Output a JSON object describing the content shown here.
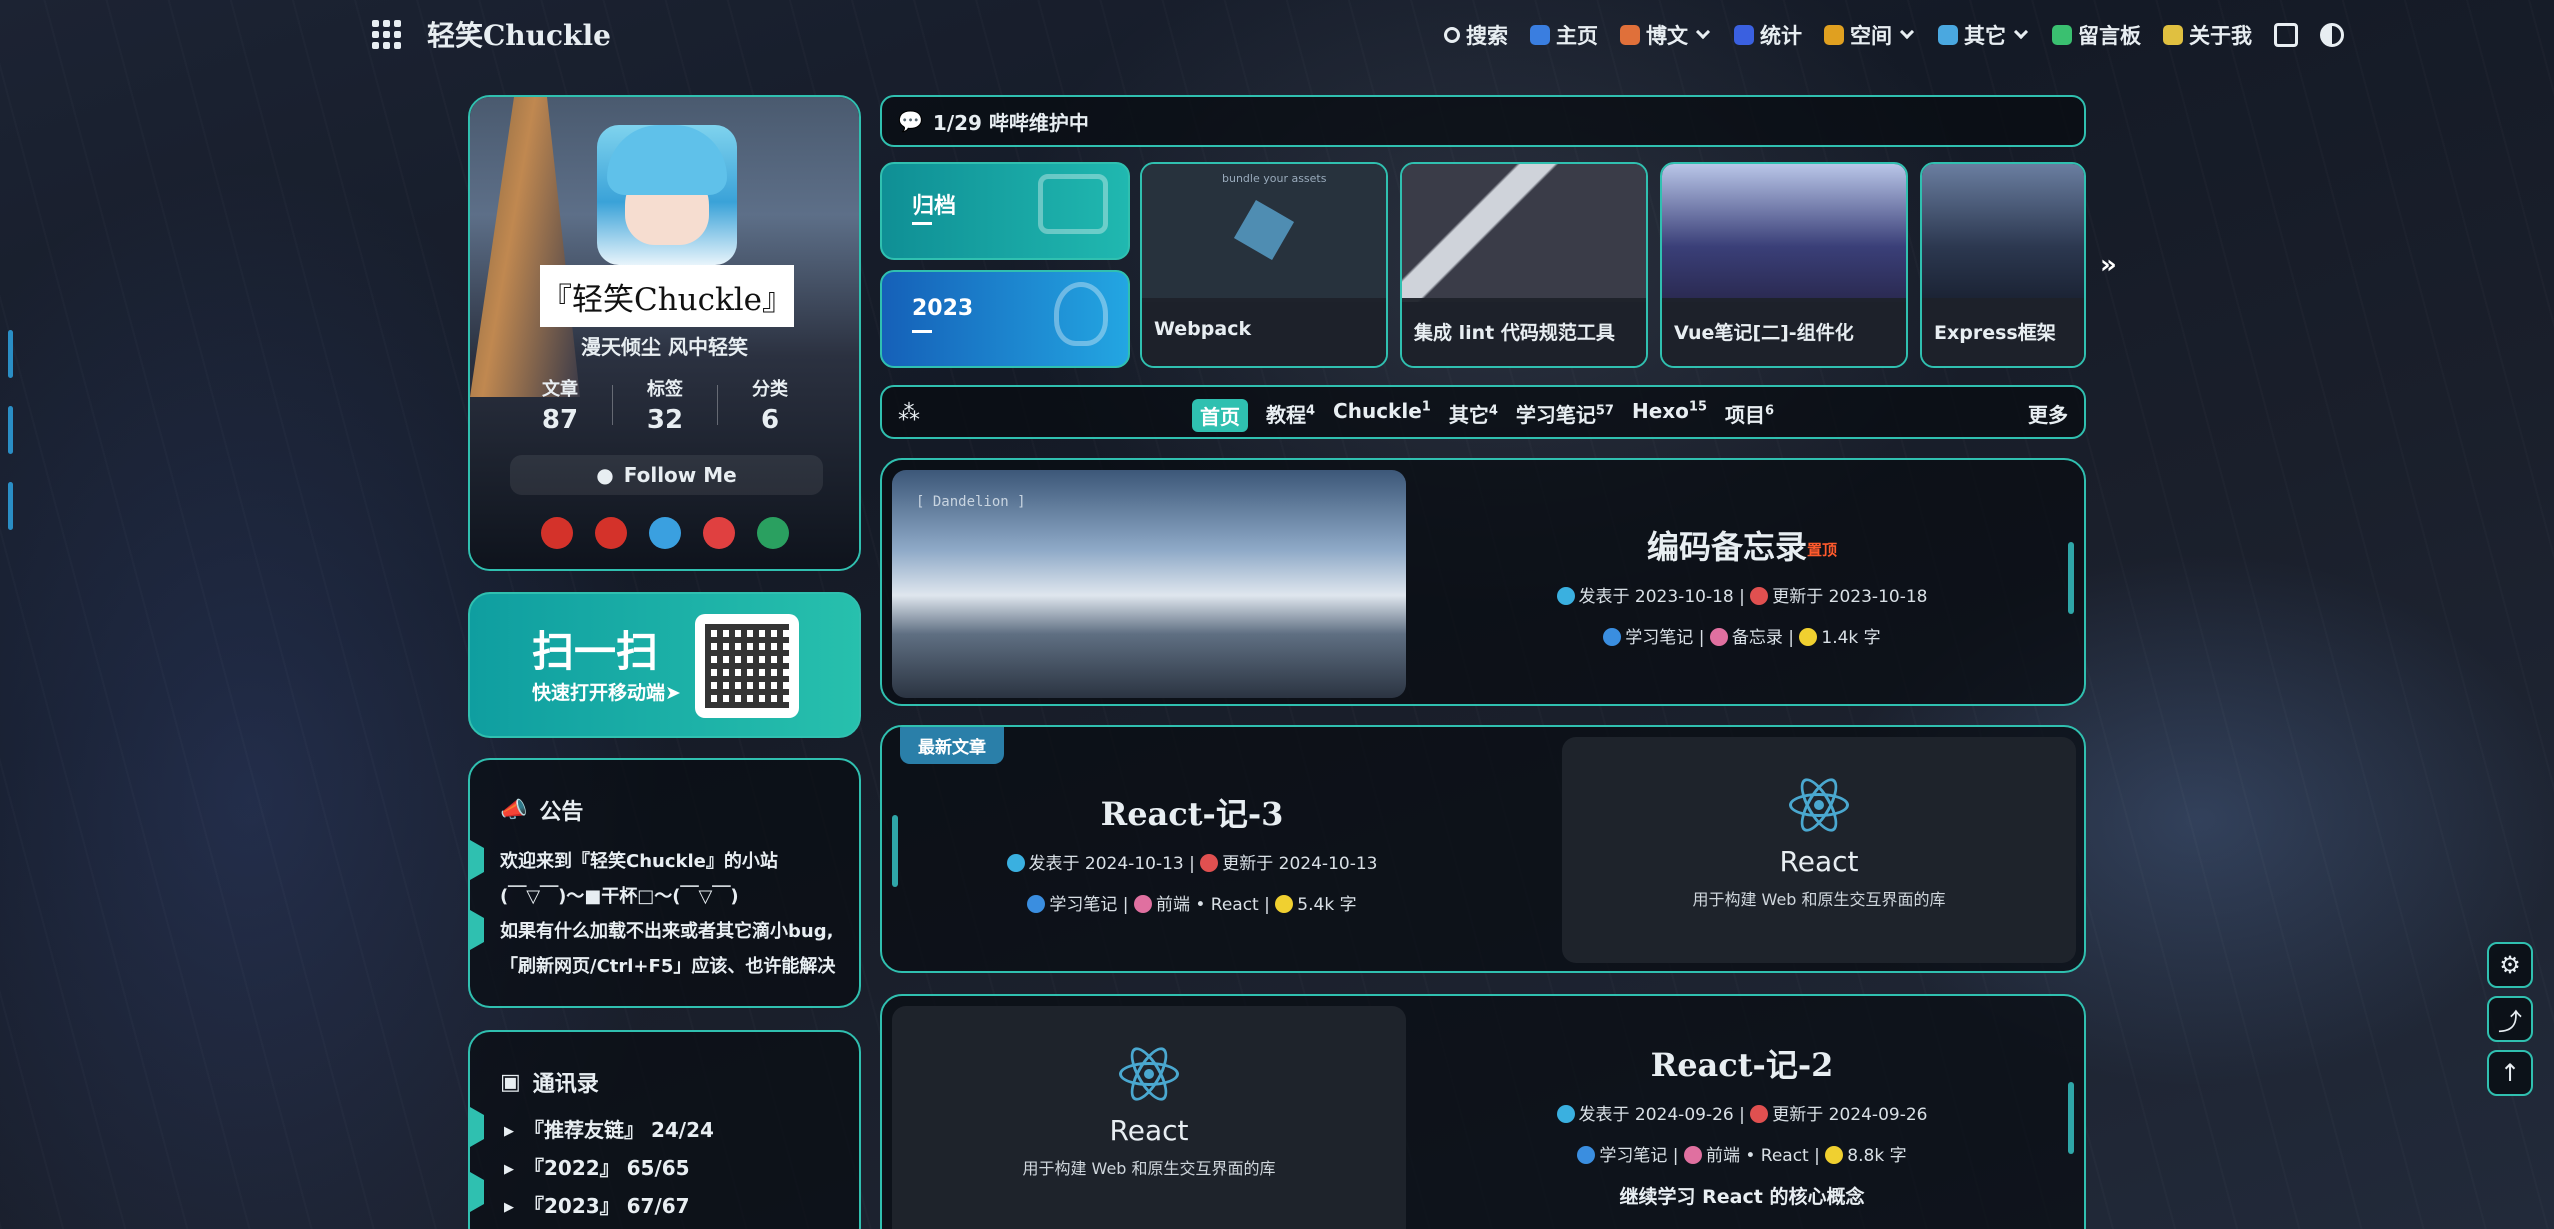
{
  "nav": {
    "brand": "轻笑Chuckle",
    "items": [
      {
        "label": "搜索",
        "icon": "search-icon",
        "color": "#e8eef2",
        "dropdown": false
      },
      {
        "label": "主页",
        "icon": "home-icon",
        "color": "#3a7ee0",
        "dropdown": false
      },
      {
        "label": "博文",
        "icon": "article-icon",
        "color": "#e0703a",
        "dropdown": true
      },
      {
        "label": "统计",
        "icon": "stats-icon",
        "color": "#3a60e0",
        "dropdown": false
      },
      {
        "label": "空间",
        "icon": "space-icon",
        "color": "#e0a020",
        "dropdown": true
      },
      {
        "label": "其它",
        "icon": "send-icon",
        "color": "#4aa8e0",
        "dropdown": true
      },
      {
        "label": "留言板",
        "icon": "message-icon",
        "color": "#3ac070",
        "dropdown": false
      },
      {
        "label": "关于我",
        "icon": "about-icon",
        "color": "#e0c040",
        "dropdown": false
      }
    ]
  },
  "profile": {
    "title": "『轻笑Chuckle』",
    "subtitle": "漫天倾尘 风中轻笑",
    "stats": [
      {
        "label": "文章",
        "value": "87"
      },
      {
        "label": "标签",
        "value": "32"
      },
      {
        "label": "分类",
        "value": "6"
      }
    ],
    "follow": "Follow Me",
    "socials": [
      {
        "name": "csdn-icon",
        "color": "#d4322a"
      },
      {
        "name": "gitee-icon",
        "color": "#d4322a"
      },
      {
        "name": "bilibili-icon",
        "color": "#3aa0e0"
      },
      {
        "name": "weibo-icon",
        "color": "#e04040"
      },
      {
        "name": "codepen-icon",
        "color": "#2aa060"
      }
    ]
  },
  "qr": {
    "title": "扫一扫",
    "subtitle": "快速打开移动端➤"
  },
  "notice": {
    "title": "公告",
    "lines": [
      "欢迎来到『轻笑Chuckle』的小站",
      "(￣▽￣)～■干杯□～(￣▽￣)",
      "如果有什么加载不出来或者其它滴小bug,",
      "「刷新网页/Ctrl+F5」应该、也许能解决"
    ]
  },
  "contact": {
    "title": "通讯录",
    "items": [
      "『推荐友链』 24/24",
      "『2022』 65/65",
      "『2023』 67/67"
    ]
  },
  "announce": "1/29 哔哔维护中",
  "categories": [
    {
      "label": "归档"
    },
    {
      "label": "2023"
    }
  ],
  "recent_posts": [
    {
      "title": "Webpack",
      "tone": "#27323d"
    },
    {
      "title": "集成 lint 代码规范工具",
      "tone": "#3a3c48"
    },
    {
      "title": "Vue笔记[二]-组件化",
      "tone": "#3a3f78"
    },
    {
      "title": "Express框架",
      "tone": "#2c3850"
    }
  ],
  "tabs": {
    "items": [
      {
        "label": "首页",
        "count": "",
        "active": true
      },
      {
        "label": "教程",
        "count": "4",
        "active": false
      },
      {
        "label": "Chuckle",
        "count": "1",
        "active": false
      },
      {
        "label": "其它",
        "count": "4",
        "active": false
      },
      {
        "label": "学习笔记",
        "count": "57",
        "active": false
      },
      {
        "label": "Hexo",
        "count": "15",
        "active": false
      },
      {
        "label": "项目",
        "count": "6",
        "active": false
      }
    ],
    "more": "更多"
  },
  "posts": [
    {
      "title": "编码备忘录",
      "pinned": "置顶",
      "published": "发表于 2023-10-18",
      "updated": "更新于 2023-10-18",
      "category": "学习笔记",
      "tags": "备忘录",
      "words": "1.4k 字",
      "image_caption": "[ Dandelion ]"
    },
    {
      "badge": "最新文章",
      "title": "React-记-3",
      "published": "发表于 2024-10-13",
      "updated": "更新于 2024-10-13",
      "category": "学习笔记",
      "tags": "前端 • React",
      "words": "5.4k 字",
      "cover_name": "React",
      "cover_desc": "用于构建 Web 和原生交互界面的库"
    },
    {
      "title": "React-记-2",
      "published": "发表于 2024-09-26",
      "updated": "更新于 2024-09-26",
      "category": "学习笔记",
      "tags": "前端 • React",
      "words": "8.8k 字",
      "excerpt": "继续学习 React 的核心概念",
      "cover_name": "React",
      "cover_desc": "用于构建 Web 和原生交互界面的库"
    }
  ],
  "webpack_note": "bundle your assets",
  "colors": {
    "accent": "#30c0b0",
    "link": "#2a7fa9"
  }
}
